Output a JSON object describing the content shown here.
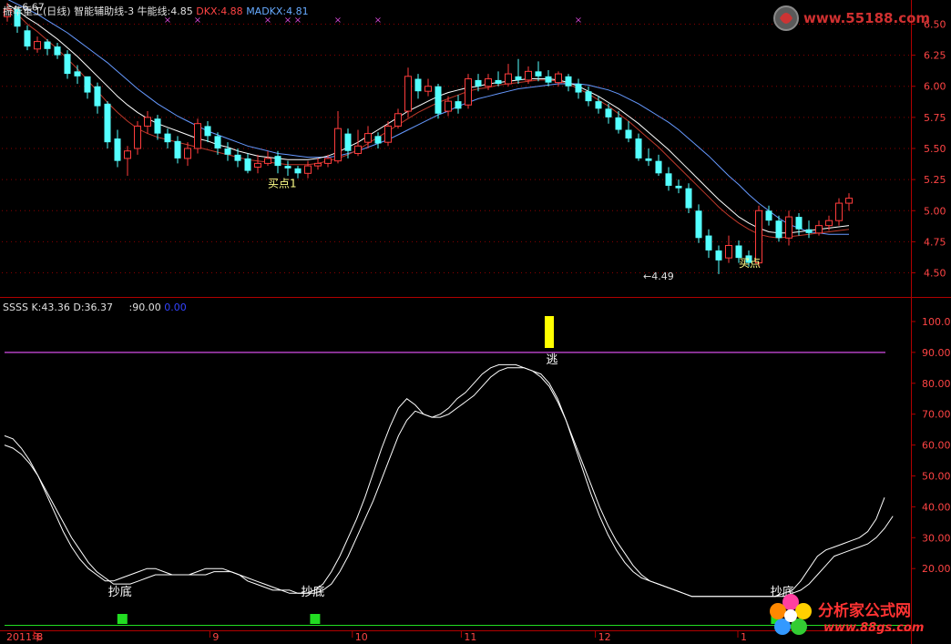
{
  "header_top": {
    "stock": "振华重工(日线)",
    "indicator": "智能辅助线-3",
    "niu_label": "牛能线:4.85",
    "dkx_label": "DKX:4.88",
    "madkx_label": "MADKX:4.81"
  },
  "header_bottom": {
    "name": "SSSS",
    "k_label": "K:43.36",
    "d_label": "D:36.37",
    "level_label": ":90.00",
    "zero_label": "0.00"
  },
  "watermarks": {
    "top_site": "www.55188.com",
    "bottom_title": "分析家公式网",
    "bottom_site": "www.88gs.com"
  },
  "colors": {
    "up": "#ff3c3c",
    "down": "#54ffff",
    "axis": "#b00000",
    "dkx": "#ffffff",
    "madkx": "#6699ff",
    "niu": "#c0392b",
    "level90": "#b040c0",
    "k_line": "#ffffff",
    "signal": "#ffff00",
    "buy": "#22dd22"
  },
  "chart_data": [
    {
      "type": "candlestick",
      "title": "振华重工(日线)",
      "ylim": [
        4.35,
        6.65
      ],
      "y_ticks": [
        6.5,
        6.25,
        6.0,
        5.75,
        5.5,
        5.25,
        5.0,
        4.75,
        4.5
      ],
      "y_tick_labels": [
        "6.50",
        "6.25",
        "6.00",
        "5.75",
        "5.50",
        "5.25",
        "5.00",
        "4.75",
        "4.50"
      ],
      "annotations": [
        {
          "text": "6.67",
          "index": 1,
          "value": 6.67
        },
        {
          "text": "4.49",
          "index": 64,
          "value": 4.49
        },
        {
          "text": "买点1",
          "index": 26,
          "value": 5.32
        },
        {
          "text": "买点",
          "index": 73,
          "value": 4.68
        }
      ],
      "x_marks": [
        16,
        19,
        26,
        28,
        29,
        33,
        37,
        57
      ],
      "candles": [
        [
          6.56,
          6.62,
          6.67,
          6.52
        ],
        [
          6.62,
          6.48,
          6.64,
          6.43
        ],
        [
          6.45,
          6.32,
          6.49,
          6.29
        ],
        [
          6.3,
          6.36,
          6.4,
          6.27
        ],
        [
          6.36,
          6.3,
          6.38,
          6.25
        ],
        [
          6.32,
          6.25,
          6.35,
          6.22
        ],
        [
          6.26,
          6.1,
          6.29,
          6.06
        ],
        [
          6.12,
          6.08,
          6.17,
          6.02
        ],
        [
          6.08,
          5.95,
          6.05,
          5.9
        ],
        [
          6.0,
          5.84,
          6.03,
          5.78
        ],
        [
          5.86,
          5.55,
          5.88,
          5.5
        ],
        [
          5.58,
          5.4,
          5.65,
          5.35
        ],
        [
          5.42,
          5.48,
          5.52,
          5.28
        ],
        [
          5.5,
          5.68,
          5.72,
          5.45
        ],
        [
          5.68,
          5.75,
          5.8,
          5.62
        ],
        [
          5.74,
          5.62,
          5.77,
          5.57
        ],
        [
          5.62,
          5.55,
          5.66,
          5.5
        ],
        [
          5.56,
          5.42,
          5.6,
          5.38
        ],
        [
          5.42,
          5.5,
          5.55,
          5.36
        ],
        [
          5.5,
          5.7,
          5.74,
          5.46
        ],
        [
          5.68,
          5.6,
          5.72,
          5.55
        ],
        [
          5.6,
          5.5,
          5.63,
          5.45
        ],
        [
          5.5,
          5.45,
          5.55,
          5.4
        ],
        [
          5.45,
          5.4,
          5.5,
          5.35
        ],
        [
          5.42,
          5.32,
          5.46,
          5.3
        ],
        [
          5.35,
          5.38,
          5.45,
          5.3
        ],
        [
          5.38,
          5.42,
          5.48,
          5.36
        ],
        [
          5.44,
          5.36,
          5.48,
          5.3
        ],
        [
          5.36,
          5.34,
          5.4,
          5.28
        ],
        [
          5.34,
          5.3,
          5.36,
          5.26
        ],
        [
          5.3,
          5.36,
          5.4,
          5.26
        ],
        [
          5.36,
          5.38,
          5.42,
          5.33
        ],
        [
          5.38,
          5.42,
          5.45,
          5.35
        ],
        [
          5.4,
          5.66,
          5.8,
          5.38
        ],
        [
          5.62,
          5.48,
          5.66,
          5.42
        ],
        [
          5.46,
          5.52,
          5.65,
          5.44
        ],
        [
          5.55,
          5.62,
          5.68,
          5.5
        ],
        [
          5.6,
          5.54,
          5.63,
          5.5
        ],
        [
          5.55,
          5.68,
          5.72,
          5.52
        ],
        [
          5.68,
          5.78,
          5.82,
          5.66
        ],
        [
          5.8,
          6.08,
          6.15,
          5.75
        ],
        [
          6.06,
          5.96,
          6.1,
          5.9
        ],
        [
          5.96,
          6.0,
          6.06,
          5.92
        ],
        [
          6.0,
          5.78,
          6.02,
          5.74
        ],
        [
          5.8,
          5.88,
          5.92,
          5.76
        ],
        [
          5.88,
          5.82,
          5.93,
          5.78
        ],
        [
          5.85,
          6.06,
          6.1,
          5.82
        ],
        [
          6.05,
          6.0,
          6.1,
          5.96
        ],
        [
          6.0,
          6.06,
          6.1,
          5.97
        ],
        [
          6.05,
          6.02,
          6.12,
          6.0
        ],
        [
          6.02,
          6.1,
          6.18,
          6.0
        ],
        [
          6.08,
          6.05,
          6.22,
          6.02
        ],
        [
          6.05,
          6.12,
          6.16,
          6.02
        ],
        [
          6.12,
          6.08,
          6.2,
          6.04
        ],
        [
          6.08,
          6.03,
          6.13,
          6.0
        ],
        [
          6.03,
          6.1,
          6.12,
          6.0
        ],
        [
          6.08,
          6.0,
          6.1,
          5.96
        ],
        [
          6.02,
          5.95,
          6.06,
          5.9
        ],
        [
          5.96,
          5.88,
          6.0,
          5.84
        ],
        [
          5.88,
          5.82,
          5.92,
          5.78
        ],
        [
          5.82,
          5.75,
          5.86,
          5.7
        ],
        [
          5.75,
          5.65,
          5.8,
          5.62
        ],
        [
          5.65,
          5.58,
          5.72,
          5.55
        ],
        [
          5.58,
          5.42,
          5.62,
          5.4
        ],
        [
          5.42,
          5.4,
          5.5,
          5.36
        ],
        [
          5.4,
          5.3,
          5.45,
          5.28
        ],
        [
          5.3,
          5.2,
          5.35,
          5.16
        ],
        [
          5.2,
          5.18,
          5.25,
          5.14
        ],
        [
          5.18,
          5.02,
          5.22,
          4.98
        ],
        [
          5.0,
          4.78,
          5.05,
          4.74
        ],
        [
          4.8,
          4.68,
          4.85,
          4.62
        ],
        [
          4.68,
          4.6,
          4.72,
          4.49
        ],
        [
          4.62,
          4.72,
          4.8,
          4.58
        ],
        [
          4.72,
          4.62,
          4.76,
          4.58
        ],
        [
          4.64,
          4.58,
          4.68,
          4.55
        ],
        [
          4.58,
          5.0,
          5.04,
          4.55
        ],
        [
          5.0,
          4.92,
          5.04,
          4.88
        ],
        [
          4.92,
          4.78,
          4.96,
          4.75
        ],
        [
          4.78,
          4.95,
          5.0,
          4.72
        ],
        [
          4.95,
          4.85,
          4.98,
          4.8
        ],
        [
          4.85,
          4.82,
          4.92,
          4.78
        ],
        [
          4.82,
          4.88,
          4.92,
          4.8
        ],
        [
          4.88,
          4.92,
          4.96,
          4.84
        ],
        [
          4.92,
          5.06,
          5.1,
          4.88
        ],
        [
          5.06,
          5.1,
          5.14,
          5.0
        ]
      ],
      "series": [
        {
          "name": "DKX",
          "values": [
            6.66,
            6.61,
            6.55,
            6.5,
            6.44,
            6.38,
            6.31,
            6.24,
            6.16,
            6.08,
            6.0,
            5.92,
            5.85,
            5.79,
            5.74,
            5.7,
            5.67,
            5.64,
            5.61,
            5.58,
            5.56,
            5.53,
            5.51,
            5.48,
            5.46,
            5.44,
            5.43,
            5.42,
            5.41,
            5.41,
            5.41,
            5.42,
            5.44,
            5.47,
            5.51,
            5.55,
            5.6,
            5.65,
            5.7,
            5.75,
            5.8,
            5.84,
            5.88,
            5.92,
            5.95,
            5.97,
            5.99,
            6.0,
            6.02,
            6.03,
            6.04,
            6.05,
            6.06,
            6.06,
            6.06,
            6.05,
            6.03,
            6.0,
            5.96,
            5.92,
            5.87,
            5.82,
            5.76,
            5.7,
            5.63,
            5.56,
            5.49,
            5.41,
            5.33,
            5.25,
            5.17,
            5.09,
            5.02,
            4.95,
            4.9,
            4.86,
            4.83,
            4.82,
            4.82,
            4.83,
            4.84,
            4.85,
            4.86,
            4.87,
            4.88
          ]
        },
        {
          "name": "MADKX",
          "values": [
            6.7,
            6.66,
            6.62,
            6.58,
            6.53,
            6.48,
            6.43,
            6.37,
            6.31,
            6.25,
            6.19,
            6.12,
            6.05,
            5.98,
            5.92,
            5.86,
            5.81,
            5.76,
            5.72,
            5.68,
            5.64,
            5.61,
            5.58,
            5.55,
            5.52,
            5.5,
            5.48,
            5.46,
            5.45,
            5.44,
            5.43,
            5.43,
            5.43,
            5.44,
            5.46,
            5.48,
            5.51,
            5.54,
            5.57,
            5.61,
            5.65,
            5.69,
            5.73,
            5.77,
            5.8,
            5.84,
            5.87,
            5.9,
            5.92,
            5.94,
            5.96,
            5.98,
            5.99,
            6.0,
            6.01,
            6.02,
            6.02,
            6.02,
            6.01,
            5.99,
            5.97,
            5.94,
            5.9,
            5.86,
            5.81,
            5.76,
            5.71,
            5.65,
            5.58,
            5.51,
            5.44,
            5.36,
            5.28,
            5.21,
            5.13,
            5.06,
            5.0,
            4.94,
            4.89,
            4.86,
            4.83,
            4.82,
            4.81,
            4.81,
            4.81
          ]
        },
        {
          "name": "牛能线",
          "values": [
            6.64,
            6.58,
            6.5,
            6.44,
            6.37,
            6.3,
            6.22,
            6.14,
            6.05,
            5.96,
            5.87,
            5.79,
            5.72,
            5.66,
            5.62,
            5.59,
            5.57,
            5.55,
            5.53,
            5.51,
            5.49,
            5.47,
            5.45,
            5.43,
            5.41,
            5.4,
            5.39,
            5.38,
            5.37,
            5.37,
            5.37,
            5.38,
            5.4,
            5.42,
            5.45,
            5.49,
            5.54,
            5.59,
            5.64,
            5.69,
            5.74,
            5.79,
            5.83,
            5.87,
            5.9,
            5.93,
            5.96,
            5.98,
            5.99,
            6.01,
            6.02,
            6.03,
            6.04,
            6.05,
            6.05,
            6.04,
            6.02,
            5.98,
            5.94,
            5.89,
            5.84,
            5.78,
            5.72,
            5.65,
            5.58,
            5.51,
            5.43,
            5.35,
            5.27,
            5.19,
            5.11,
            5.03,
            4.96,
            4.9,
            4.85,
            4.81,
            4.79,
            4.78,
            4.79,
            4.8,
            4.81,
            4.82,
            4.83,
            4.84,
            4.85
          ]
        }
      ]
    },
    {
      "type": "line",
      "title": "SSSS",
      "ylim": [
        0,
        105
      ],
      "y_ticks": [
        100,
        90,
        80,
        70,
        60,
        50,
        40,
        30,
        20
      ],
      "y_tick_labels": [
        "100.0",
        "90.00",
        "80.00",
        "70.00",
        "60.00",
        "50.00",
        "40.00",
        "30.00",
        "20.00"
      ],
      "level": 90,
      "x_tick_labels": [
        {
          "text": "2011年",
          "index": 0
        },
        {
          "text": "8",
          "index": 3.5
        },
        {
          "text": "9",
          "index": 24.5
        },
        {
          "text": "10",
          "index": 41.5
        },
        {
          "text": "11",
          "index": 54.5
        },
        {
          "text": "12",
          "index": 70.5
        },
        {
          "text": "1",
          "index": 87.5
        }
      ],
      "annotations": [
        {
          "text": "抄底",
          "index": 14,
          "value": 11
        },
        {
          "text": "抄底",
          "index": 37,
          "value": 11
        },
        {
          "text": "逃",
          "index": 65,
          "value": 87
        },
        {
          "text": "抄底",
          "index": 93,
          "value": 11
        }
      ],
      "buy_markers": [
        14,
        37,
        92
      ],
      "sell_markers": [
        65
      ],
      "series": [
        {
          "name": "K",
          "values": [
            63,
            62,
            59,
            55,
            50,
            44,
            38,
            32,
            27,
            23,
            20,
            18,
            16,
            16,
            17,
            18,
            19,
            20,
            20,
            19,
            18,
            18,
            18,
            19,
            20,
            20,
            20,
            19,
            18,
            16,
            15,
            14,
            13,
            13,
            12,
            12,
            12,
            13,
            15,
            19,
            24,
            30,
            36,
            43,
            51,
            59,
            66,
            72,
            75,
            73,
            70,
            69,
            70,
            72,
            75,
            77,
            80,
            83,
            85,
            86,
            86,
            86,
            85,
            84,
            83,
            80,
            75,
            68,
            60,
            52,
            44,
            37,
            31,
            26,
            22,
            19,
            17,
            16,
            15,
            14,
            13,
            12,
            11,
            11,
            11,
            11,
            11,
            11,
            11,
            11,
            11,
            11,
            11,
            12,
            13,
            16,
            20,
            24,
            26,
            27,
            28,
            29,
            30,
            32,
            36,
            43
          ]
        },
        {
          "name": "D",
          "values": [
            60,
            59,
            57,
            54,
            50,
            45,
            40,
            35,
            30,
            26,
            22,
            19,
            17,
            15,
            15,
            15,
            16,
            17,
            18,
            18,
            18,
            18,
            18,
            18,
            18,
            19,
            19,
            19,
            18,
            17,
            16,
            15,
            14,
            13,
            13,
            12,
            12,
            12,
            13,
            15,
            19,
            24,
            30,
            36,
            42,
            49,
            56,
            63,
            68,
            71,
            70,
            69,
            69,
            70,
            72,
            74,
            76,
            79,
            82,
            84,
            85,
            85,
            85,
            84,
            82,
            79,
            74,
            68,
            61,
            54,
            47,
            40,
            34,
            29,
            25,
            21,
            18,
            16,
            15,
            14,
            13,
            12,
            11,
            11,
            11,
            11,
            11,
            11,
            11,
            11,
            11,
            11,
            11,
            11,
            12,
            13,
            15,
            18,
            21,
            24,
            25,
            26,
            27,
            28,
            30,
            33,
            37
          ]
        }
      ]
    }
  ]
}
